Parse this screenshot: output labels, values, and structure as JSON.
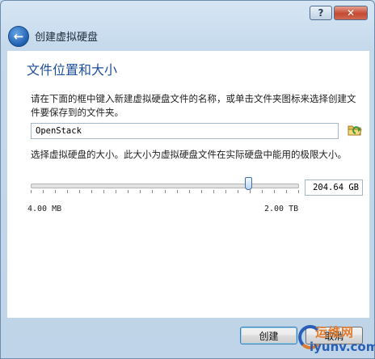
{
  "window": {
    "help_label": "?",
    "close_label": "✕"
  },
  "wizard": {
    "title": "创建虚拟硬盘",
    "back_icon": "back-arrow-icon"
  },
  "page": {
    "heading": "文件位置和大小",
    "location_description": "请在下面的框中键入新建虚拟硬盘文件的名称，或单击文件夹图标来选择创建文件要保存到的文件夹。",
    "file_name_value": "OpenStack",
    "folder_icon": "folder-browse-icon",
    "size_description": "选择虚拟硬盘的大小。此大小为虚拟硬盘文件在实际硬盘中能用的极限大小。",
    "size_value": "204.64 GB",
    "size_slider_fraction": 0.81,
    "range_min": "4.00 MB",
    "range_max": "2.00 TB"
  },
  "buttons": {
    "create": "创建",
    "cancel": "取消"
  },
  "watermark": {
    "top": "运维网",
    "bottom": "iyunv.com"
  },
  "colors": {
    "heading": "#1e4f9a",
    "title_bar": "#c5d9ec",
    "close_button": "#c44a32"
  }
}
